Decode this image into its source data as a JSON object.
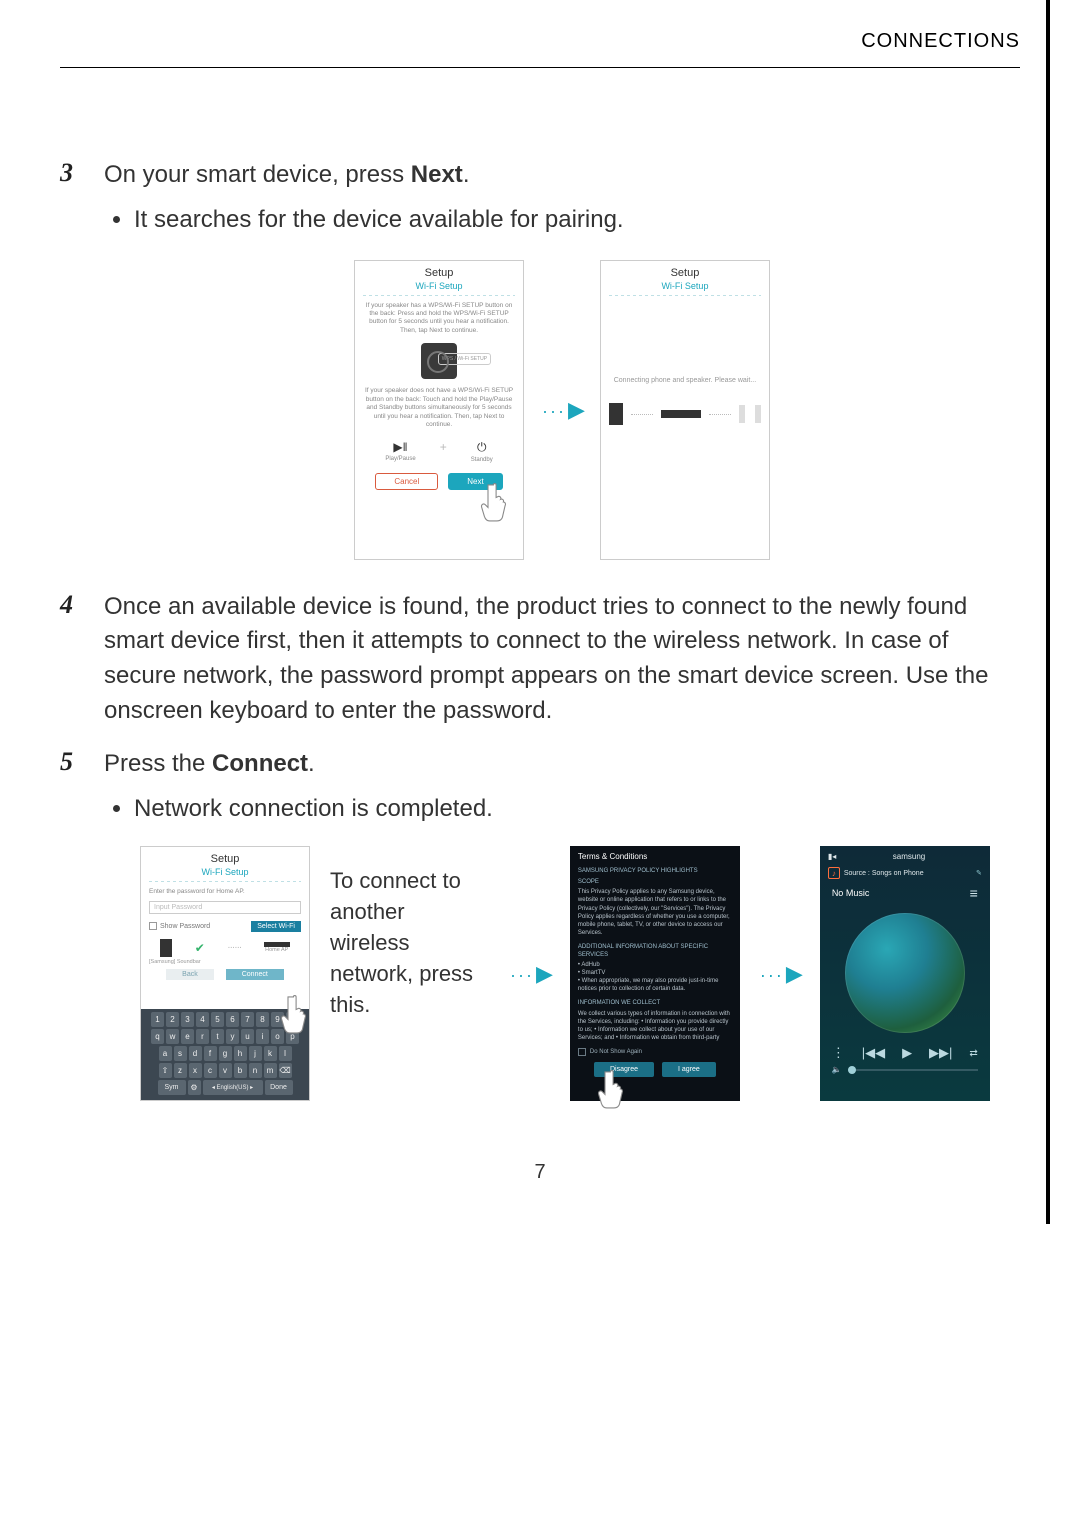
{
  "header": {
    "title": "CONNECTIONS"
  },
  "page_number": "7",
  "steps": [
    {
      "num": "3",
      "text_pre": "On your smart device, press ",
      "text_bold": "Next",
      "text_post": ".",
      "bullets": [
        "It searches for the device available for pairing."
      ]
    },
    {
      "num": "4",
      "text_full": "Once an available device is found, the product tries to connect to the newly found smart device first, then it attempts to connect to the wireless network. In case of secure network, the password prompt appears on the smart device screen. Use the onscreen keyboard to enter the password."
    },
    {
      "num": "5",
      "text_pre": "Press the ",
      "text_bold": "Connect",
      "text_post": ".",
      "bullets": [
        "Network connection is completed."
      ]
    }
  ],
  "fig3": {
    "phone1": {
      "title": "Setup",
      "subtitle": "Wi-Fi Setup",
      "para1": "If your speaker has a WPS/Wi-Fi SETUP button on the back:\nPress and hold the WPS/Wi-Fi SETUP button for 5 seconds until you hear a notification.\nThen, tap Next to continue.",
      "wps_label": "WPS /\nWi-Fi SETUP",
      "para2": "If your speaker does not have a WPS/Wi-Fi SETUP button on the back:\nTouch and hold the Play/Pause and Standby buttons simultaneously for 5 seconds until you hear a notification.\nThen, tap Next to continue.",
      "play_label": "Play/Pause",
      "standby_label": "Standby",
      "cancel": "Cancel",
      "next": "Next"
    },
    "phone2": {
      "title": "Setup",
      "subtitle": "Wi-Fi Setup",
      "msg": "Connecting phone and speaker.\nPlease wait..."
    }
  },
  "fig5": {
    "callout": "To connect to another wireless network, press this.",
    "phone1": {
      "title": "Setup",
      "subtitle": "Wi-Fi Setup",
      "prompt": "Enter the password for Home AP.",
      "placeholder": "Input Password",
      "show_pw": "Show Password",
      "select_wifi": "Select Wi-Fi",
      "home_ap": "Home AP",
      "soundbar": "[Samsung] Soundbar",
      "back": "Back",
      "connect": "Connect",
      "kb_nums": [
        "1",
        "2",
        "3",
        "4",
        "5",
        "6",
        "7",
        "8",
        "9",
        "0"
      ],
      "kb_r1": [
        "q",
        "w",
        "e",
        "r",
        "t",
        "y",
        "u",
        "i",
        "o",
        "p"
      ],
      "kb_r2": [
        "a",
        "s",
        "d",
        "f",
        "g",
        "h",
        "j",
        "k",
        "l"
      ],
      "kb_r3": [
        "⇧",
        "z",
        "x",
        "c",
        "v",
        "b",
        "n",
        "m",
        "⌫"
      ],
      "kb_r4": [
        "Sym",
        "⚙",
        "◂ English(US) ▸",
        "Done"
      ]
    },
    "phone2": {
      "title": "Terms & Conditions",
      "heading": "SAMSUNG PRIVACY POLICY HIGHLIGHTS",
      "scope_label": "Scope",
      "scope": "This Privacy Policy applies to any Samsung device, website or online application that refers to or links to the Privacy Policy (collectively, our \"Services\"). The Privacy Policy applies regardless of whether you use a computer, mobile phone, tablet, TV, or other device to access our Services.",
      "addl_label": "Additional Information About Specific Services",
      "addl1": "• AdHub",
      "addl2": "• SmartTV",
      "addl3": "• When appropriate, we may also provide just-in-time notices prior to collection of certain data.",
      "info_collect_label": "Information We Collect",
      "info_collect": "We collect various types of information in connection with the Services, including:\n• Information you provide directly to us;\n• Information we collect about your use of our Services; and\n• Information we obtain from third-party",
      "do_not_show": "Do Not Show Again",
      "disagree": "Disagree",
      "agree": "I agree"
    },
    "phone3": {
      "brand": "samsung",
      "source": "Source : Songs on Phone",
      "no_music": "No Music",
      "shuffle": "⇄"
    }
  }
}
